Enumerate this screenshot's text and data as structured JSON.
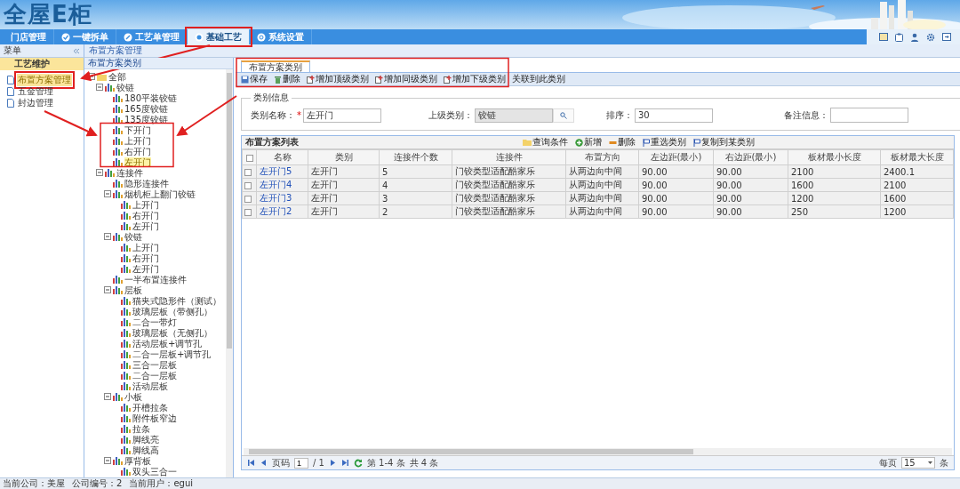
{
  "header": {
    "logo": "全屋E柜"
  },
  "nav": [
    {
      "label": "门店管理",
      "selected": false,
      "highlighted": false
    },
    {
      "label": "一键拆单",
      "selected": false,
      "highlighted": false
    },
    {
      "label": "工艺单管理",
      "selected": false,
      "highlighted": false
    },
    {
      "label": "基础工艺",
      "selected": true,
      "highlighted": true
    },
    {
      "label": "系统设置",
      "selected": false,
      "highlighted": false
    }
  ],
  "sidebar": {
    "title": "菜单",
    "section": "工艺维护",
    "items": [
      {
        "label": "布置方案管理",
        "selected": true,
        "highlighted": true
      },
      {
        "label": "五金管理",
        "selected": false,
        "highlighted": false
      },
      {
        "label": "封边管理",
        "selected": false,
        "highlighted": false
      }
    ]
  },
  "breadcrumb": "布置方案管理",
  "tree_panel": {
    "title": "布置方案类别",
    "tree": [
      {
        "label": "全部",
        "kind": "folder",
        "expanded": true,
        "selected": false,
        "children": [
          {
            "label": "铰链",
            "kind": "category",
            "expanded": true,
            "selected": false,
            "children": [
              {
                "label": "180平装铰链",
                "kind": "category",
                "selected": false
              },
              {
                "label": "165度铰链",
                "kind": "category",
                "selected": false
              },
              {
                "label": "135度铰链",
                "kind": "category",
                "selected": false
              },
              {
                "label": "下开门",
                "kind": "category",
                "selected": false
              },
              {
                "label": "上开门",
                "kind": "category",
                "selected": false
              },
              {
                "label": "右开门",
                "kind": "category",
                "selected": false
              },
              {
                "label": "左开门",
                "kind": "category",
                "selected": true
              }
            ]
          },
          {
            "label": "连接件",
            "kind": "category",
            "expanded": true,
            "selected": false,
            "children": [
              {
                "label": "隐形连接件",
                "kind": "category",
                "selected": false
              },
              {
                "label": "烟机柜上翻门铰链",
                "kind": "category",
                "expanded": true,
                "selected": false,
                "children": [
                  {
                    "label": "上开门",
                    "kind": "category",
                    "selected": false
                  },
                  {
                    "label": "右开门",
                    "kind": "category",
                    "selected": false
                  },
                  {
                    "label": "左开门",
                    "kind": "category",
                    "selected": false
                  }
                ]
              },
              {
                "label": "铰链",
                "kind": "category",
                "expanded": true,
                "selected": false,
                "children": [
                  {
                    "label": "上开门",
                    "kind": "category",
                    "selected": false
                  },
                  {
                    "label": "右开门",
                    "kind": "category",
                    "selected": false
                  },
                  {
                    "label": "左开门",
                    "kind": "category",
                    "selected": false
                  }
                ]
              },
              {
                "label": "一半布置连接件",
                "kind": "category",
                "selected": false
              },
              {
                "label": "层板",
                "kind": "category",
                "expanded": true,
                "selected": false,
                "children": [
                  {
                    "label": "猫夹式隐形件（测试）",
                    "kind": "category",
                    "selected": false
                  },
                  {
                    "label": "玻璃层板（带侧孔）",
                    "kind": "category",
                    "selected": false
                  },
                  {
                    "label": "二合一带灯",
                    "kind": "category",
                    "selected": false
                  },
                  {
                    "label": "玻璃层板（无侧孔）",
                    "kind": "category",
                    "selected": false
                  },
                  {
                    "label": "活动层板+调节孔",
                    "kind": "category",
                    "selected": false
                  },
                  {
                    "label": "二合一层板+调节孔",
                    "kind": "category",
                    "selected": false
                  },
                  {
                    "label": "三合一层板",
                    "kind": "category",
                    "selected": false
                  },
                  {
                    "label": "二合一层板",
                    "kind": "category",
                    "selected": false
                  },
                  {
                    "label": "活动层板",
                    "kind": "category",
                    "selected": false
                  }
                ]
              },
              {
                "label": "小板",
                "kind": "category",
                "expanded": true,
                "selected": false,
                "children": [
                  {
                    "label": "开槽拉条",
                    "kind": "category",
                    "selected": false
                  },
                  {
                    "label": "附件板窄边",
                    "kind": "category",
                    "selected": false
                  },
                  {
                    "label": "拉条",
                    "kind": "category",
                    "selected": false
                  },
                  {
                    "label": "脚线亮",
                    "kind": "category",
                    "selected": false
                  },
                  {
                    "label": "脚线高",
                    "kind": "category",
                    "selected": false
                  }
                ]
              },
              {
                "label": "厚背板",
                "kind": "category",
                "expanded": true,
                "selected": false,
                "children": [
                  {
                    "label": "双头三合一",
                    "kind": "category",
                    "selected": false
                  }
                ]
              }
            ]
          }
        ]
      }
    ]
  },
  "tab": {
    "label": "布置方案类别"
  },
  "toolbar": [
    {
      "label": "保存",
      "kind": "save"
    },
    {
      "label": "删除",
      "kind": "delete"
    },
    {
      "label": "增加顶级类别",
      "kind": "add"
    },
    {
      "label": "增加同级类别",
      "kind": "add"
    },
    {
      "label": "增加下级类别",
      "kind": "add"
    },
    {
      "label": "关联到此类别",
      "kind": "plain"
    }
  ],
  "form": {
    "legend": "类别信息",
    "fields": [
      {
        "label": "类别名称：",
        "required_mark": "*",
        "value": "左开门",
        "kind": "text"
      },
      {
        "label": "上级类别：",
        "value": "铰链",
        "kind": "lookup"
      },
      {
        "label": "排序：",
        "value": "30",
        "kind": "text"
      },
      {
        "label": "备注信息：",
        "kind": "textarea"
      }
    ]
  },
  "table": {
    "title": "布置方案列表",
    "select_all_checked": false,
    "actions": [
      {
        "label": "查询条件",
        "kind": "query"
      },
      {
        "label": "新增",
        "kind": "add"
      },
      {
        "label": "删除",
        "kind": "delete"
      },
      {
        "label": "重选类别",
        "kind": "flag"
      },
      {
        "label": "复制到某类别",
        "kind": "flag"
      }
    ],
    "columns": [
      "名称",
      "类别",
      "连接件个数",
      "连接件",
      "布置方向",
      "左边距(最小)",
      "右边距(最小)",
      "板材最小长度",
      "板材最大长度"
    ],
    "rows": [
      {
        "checked": false,
        "cells": [
          "左开门5",
          "左开门",
          "5",
          "门铰类型适配酷家乐",
          "从两边向中间",
          "90.00",
          "90.00",
          "2100",
          "2400.1"
        ]
      },
      {
        "checked": false,
        "cells": [
          "左开门4",
          "左开门",
          "4",
          "门铰类型适配酷家乐",
          "从两边向中间",
          "90.00",
          "90.00",
          "1600",
          "2100"
        ]
      },
      {
        "checked": false,
        "cells": [
          "左开门3",
          "左开门",
          "3",
          "门铰类型适配酷家乐",
          "从两边向中间",
          "90.00",
          "90.00",
          "1200",
          "1600"
        ]
      },
      {
        "checked": false,
        "cells": [
          "左开门2",
          "左开门",
          "2",
          "门铰类型适配酷家乐",
          "从两边向中间",
          "90.00",
          "90.00",
          "250",
          "1200"
        ]
      }
    ]
  },
  "pager": {
    "page_label": "页码",
    "page": "1",
    "pages": "/ 1",
    "range": "第 1-4 条",
    "total": "共 4 条",
    "per_page_label": "每页",
    "per_page": "15",
    "per_page_unit": "条"
  },
  "status_bar": {
    "company_label": "当前公司：",
    "company": "美屋",
    "code_label": "公司编号：",
    "code": "2",
    "user_label": "当前用户：",
    "user": "egui"
  }
}
